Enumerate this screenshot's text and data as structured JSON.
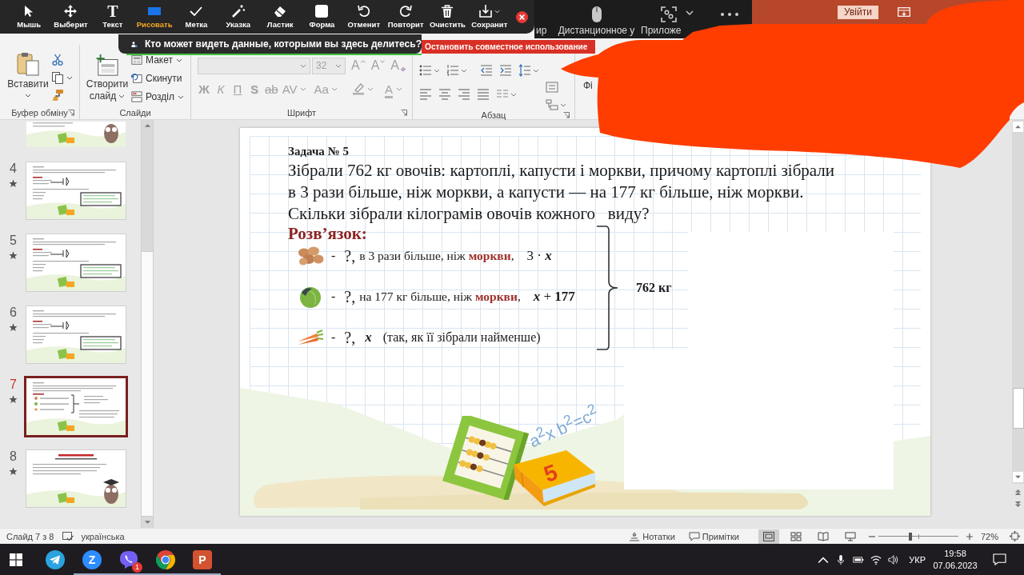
{
  "zoom_toolbar": {
    "tools": [
      {
        "kind": "mouse",
        "label": "Мышь",
        "selected": false
      },
      {
        "kind": "select",
        "label": "Выберит",
        "selected": false
      },
      {
        "kind": "text",
        "glyph": "T",
        "label": "Текст",
        "selected": false
      },
      {
        "kind": "draw",
        "label": "Рисовать",
        "selected": true
      },
      {
        "kind": "stamp",
        "label": "Метка",
        "selected": false
      },
      {
        "kind": "spotlight",
        "label": "Указка",
        "selected": false
      },
      {
        "kind": "eraser",
        "label": "Ластик",
        "selected": false
      },
      {
        "kind": "format",
        "label": "Форма",
        "selected": false
      },
      {
        "kind": "undo",
        "label": "Отменит",
        "selected": false
      },
      {
        "kind": "redo",
        "label": "Повторит",
        "selected": false
      },
      {
        "kind": "clear",
        "label": "Очистить",
        "selected": false
      },
      {
        "kind": "save",
        "label": "Сохранит",
        "selected": false
      }
    ]
  },
  "share_notice": "Кто может видеть данные, которыми вы здесь делитесь?",
  "stop_share": "Остановить совместное использование",
  "zoom_bar": {
    "items": [
      {
        "kind": "label",
        "label": "ир"
      },
      {
        "kind": "mouse",
        "label": "Дистанционное у"
      },
      {
        "kind": "apps",
        "label": "Приложе"
      },
      {
        "kind": "more"
      }
    ]
  },
  "title_bar": {
    "sign_in": "Увійти"
  },
  "ribbon": {
    "groups": [
      {
        "kind": "clipboard",
        "label": "Буфер обміну",
        "paste": "Вставити"
      },
      {
        "kind": "slides",
        "label": "Слайди",
        "new_slide": "Створити слайд",
        "items": [
          {
            "kind": "layout",
            "label": "Макет",
            "menu": true
          },
          {
            "kind": "reset",
            "label": "Скинути",
            "menu": false
          },
          {
            "kind": "section",
            "label": "Розділ",
            "menu": true
          }
        ]
      },
      {
        "kind": "font",
        "label": "Шрифт",
        "disabled": true,
        "size": "32",
        "sizing": [
          {
            "kind": "grow",
            "text": "A"
          },
          {
            "kind": "shrink",
            "text": "A"
          },
          {
            "kind": "clear",
            "text": "A"
          }
        ],
        "styles": [
          {
            "kind": "bold",
            "text": "Ж"
          },
          {
            "kind": "italic",
            "text": "К"
          },
          {
            "kind": "underline",
            "text": "П"
          },
          {
            "kind": "shadow",
            "text": "S"
          },
          {
            "kind": "strike",
            "text": "ab"
          },
          {
            "kind": "spacing",
            "text": "AV"
          },
          {
            "kind": "case",
            "text": "Aa"
          }
        ],
        "color_text": "A"
      },
      {
        "kind": "paragraph",
        "label": "Абзац"
      }
    ],
    "cut_label": "Фі"
  },
  "slides_panel": {
    "partial": {
      "kind": "owl"
    },
    "slides": [
      {
        "number": "4",
        "kind": "boxed",
        "animated": true,
        "selected": false
      },
      {
        "number": "5",
        "kind": "boxed",
        "animated": true,
        "selected": false
      },
      {
        "number": "6",
        "kind": "boxed",
        "animated": true,
        "selected": false
      },
      {
        "number": "7",
        "kind": "brace",
        "animated": true,
        "selected": true
      },
      {
        "number": "8",
        "kind": "homework",
        "animated": true,
        "selected": false
      }
    ]
  },
  "slide": {
    "task_title": "Задача № 5",
    "problem_lines": [
      "Зібрали 762 кг овочів: картоплі, капусти і моркви, причому картоплі зібрали",
      "в 3 рази більше, ніж моркви, а капусти — на 177 кг більше, ніж моркви.",
      "Скільки зібрали кілограмів овочів кожного   виду?"
    ],
    "solution_heading": "Розв’язок:",
    "rows": [
      {
        "kind": "potato",
        "parts": [
          {
            "kind": "dash",
            "text": "-"
          },
          {
            "kind": "question",
            "text": "?,"
          },
          {
            "kind": "text",
            "text": "в 3 рази більше, ніж **моркви**,"
          },
          {
            "kind": "math",
            "text": "3 · *x*"
          }
        ]
      },
      {
        "kind": "cabbage",
        "parts": [
          {
            "kind": "dash",
            "text": "-"
          },
          {
            "kind": "question",
            "text": "?,"
          },
          {
            "kind": "text",
            "text": "на 177 кг більше, ніж **моркви**,"
          },
          {
            "kind": "math",
            "text": "*x* + **177**"
          }
        ]
      },
      {
        "kind": "carrot",
        "parts": [
          {
            "kind": "dash",
            "text": "-"
          },
          {
            "kind": "question",
            "text": "?,"
          },
          {
            "kind": "math",
            "text": "*x*"
          },
          {
            "kind": "text",
            "text": "(так, як її зібрали найменше)"
          }
        ]
      }
    ],
    "total": "762 кг",
    "formula": "a$^{2}$x b$^{2}$=c$^{2}$",
    "book_label": "5"
  },
  "status_bar": {
    "slide_info": "Слайд 7 з 8",
    "language": "українська",
    "notes": "Нотатки",
    "comments": "Примітки",
    "views": [
      {
        "kind": "normal",
        "selected": true
      },
      {
        "kind": "sorter",
        "selected": false
      },
      {
        "kind": "reading",
        "selected": false
      },
      {
        "kind": "show",
        "selected": false
      }
    ],
    "zoom": {
      "level": 0.4,
      "reading": "72%"
    }
  },
  "taskbar": {
    "apps": [
      {
        "kind": "telegram",
        "running": false
      },
      {
        "kind": "zoom",
        "glyph": "Z",
        "running": true
      },
      {
        "kind": "viber",
        "badge": "1",
        "running": true
      },
      {
        "kind": "chrome",
        "running": true
      },
      {
        "kind": "powerpoint",
        "glyph": "P",
        "running": true
      }
    ],
    "language": "УКР",
    "time": "19:58",
    "date": "07.06.2023"
  }
}
